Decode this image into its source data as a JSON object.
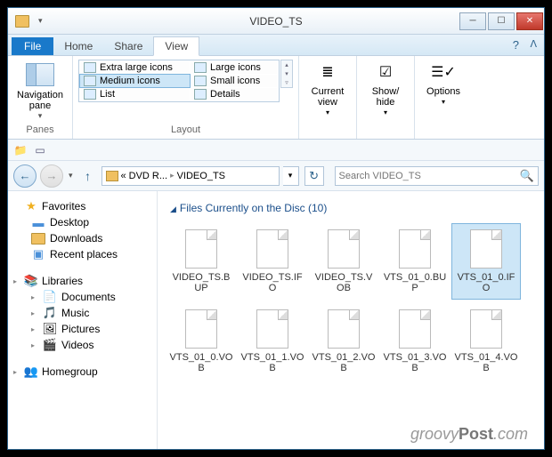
{
  "window": {
    "title": "VIDEO_TS"
  },
  "tabs": {
    "file": "File",
    "home": "Home",
    "share": "Share",
    "view": "View"
  },
  "ribbon": {
    "panes_label": "Panes",
    "nav_label": "Navigation\npane",
    "layout_label": "Layout",
    "layout_items": {
      "xl": "Extra large icons",
      "lg": "Large icons",
      "md": "Medium icons",
      "sm": "Small icons",
      "list": "List",
      "details": "Details"
    },
    "current_view": "Current\nview",
    "show_hide": "Show/\nhide",
    "options": "Options"
  },
  "breadcrumb": {
    "a": "«",
    "b": "DVD R...",
    "c": "VIDEO_TS"
  },
  "search": {
    "placeholder": "Search VIDEO_TS"
  },
  "section_header": "Files Currently on the Disc (10)",
  "tree": {
    "favorites": "Favorites",
    "desktop": "Desktop",
    "downloads": "Downloads",
    "recent": "Recent places",
    "libraries": "Libraries",
    "documents": "Documents",
    "music": "Music",
    "pictures": "Pictures",
    "videos": "Videos",
    "homegroup": "Homegroup"
  },
  "files": [
    {
      "name": "VIDEO_TS.BUP",
      "sel": false
    },
    {
      "name": "VIDEO_TS.IFO",
      "sel": false
    },
    {
      "name": "VIDEO_TS.VOB",
      "sel": false
    },
    {
      "name": "VTS_01_0.BUP",
      "sel": false
    },
    {
      "name": "VTS_01_0.IFO",
      "sel": true
    },
    {
      "name": "VTS_01_0.VOB",
      "sel": false
    },
    {
      "name": "VTS_01_1.VOB",
      "sel": false
    },
    {
      "name": "VTS_01_2.VOB",
      "sel": false
    },
    {
      "name": "VTS_01_3.VOB",
      "sel": false
    },
    {
      "name": "VTS_01_4.VOB",
      "sel": false
    }
  ],
  "watermark": {
    "a": "groovy",
    "b": "Post",
    "c": ".com"
  }
}
